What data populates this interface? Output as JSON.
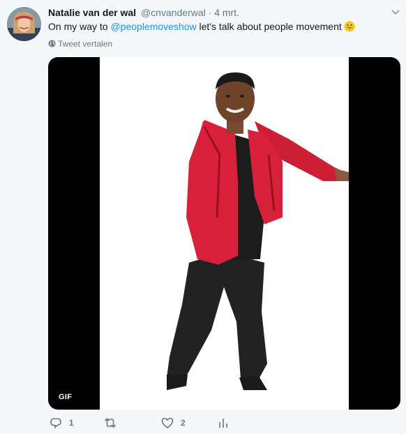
{
  "tweet": {
    "author_name": "Natalie van der wal",
    "handle": "@cnvanderwal",
    "separator": "·",
    "date": "4 mrt.",
    "text_before": "On my way to ",
    "mention": "@peoplemoveshow",
    "text_after": " let's talk about people movement",
    "emoji": "grinning-face-emoji",
    "translate_label": "Tweet vertalen",
    "media_badge": "GIF"
  },
  "actions": {
    "reply_count": "1",
    "retweet_count": "",
    "like_count": "2"
  },
  "colors": {
    "link": "#1b95e0",
    "secondary_text": "#657786",
    "background": "#f5f8fa",
    "jacket_red": "#d8203a"
  },
  "icons": [
    "chevron-down-icon",
    "globe-icon",
    "reply-icon",
    "retweet-icon",
    "like-icon",
    "analytics-icon"
  ]
}
